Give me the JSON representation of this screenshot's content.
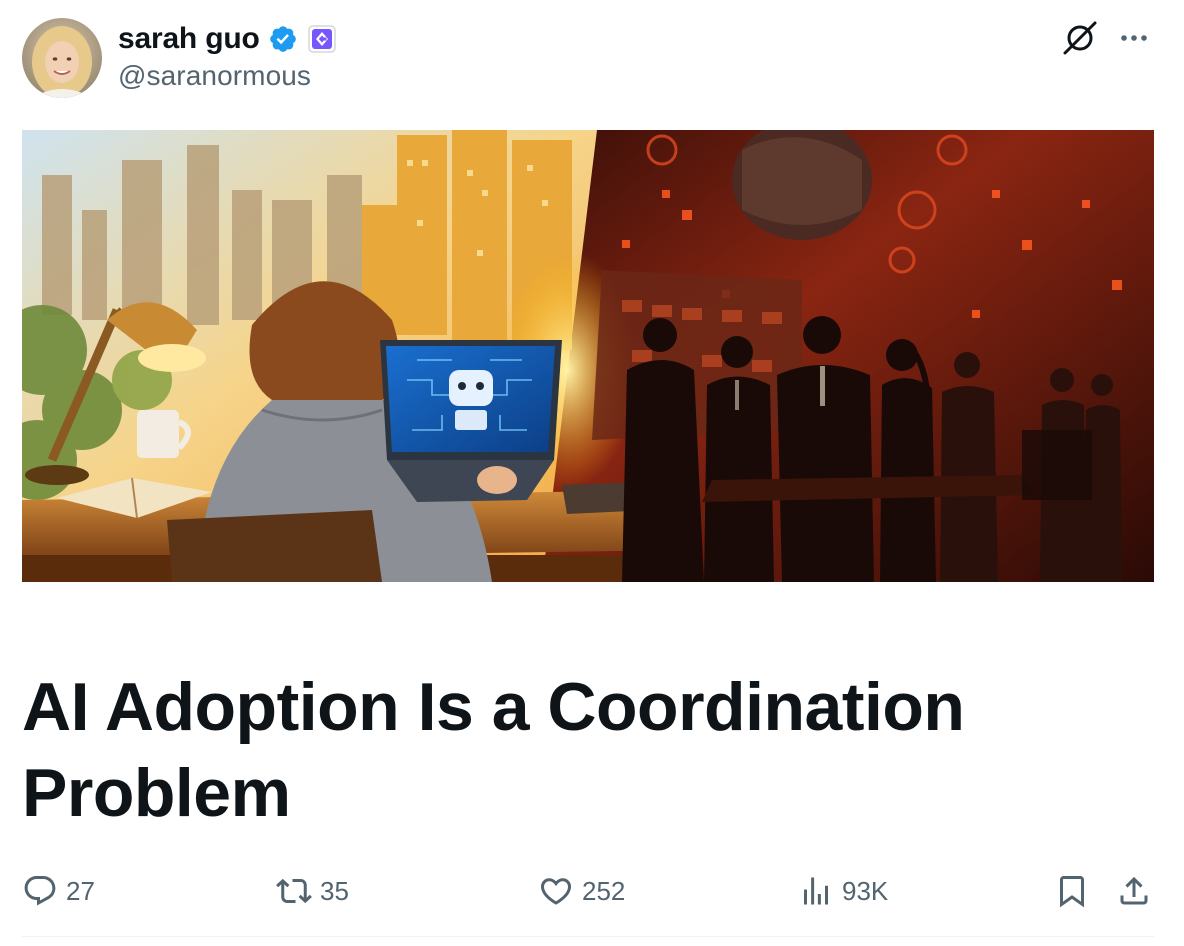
{
  "author": {
    "display_name": "sarah guo",
    "handle": "@saranormous"
  },
  "icons": {
    "verified": "verified-badge-icon",
    "affiliation": "affiliation-badge-icon",
    "grok": "grok-icon",
    "more": "more-icon",
    "reply": "reply-icon",
    "repost": "repost-icon",
    "like": "heart-icon",
    "views": "views-icon",
    "bookmark": "bookmark-icon",
    "share": "share-icon"
  },
  "colors": {
    "verified_blue": "#1d9bf0",
    "affiliation_purple": "#7856ff",
    "text_primary": "#0f1419",
    "text_secondary": "#536471"
  },
  "article": {
    "title": "AI Adoption Is a Coordination Problem"
  },
  "stats": {
    "replies": "27",
    "reposts": "35",
    "likes": "252",
    "views": "93K"
  }
}
